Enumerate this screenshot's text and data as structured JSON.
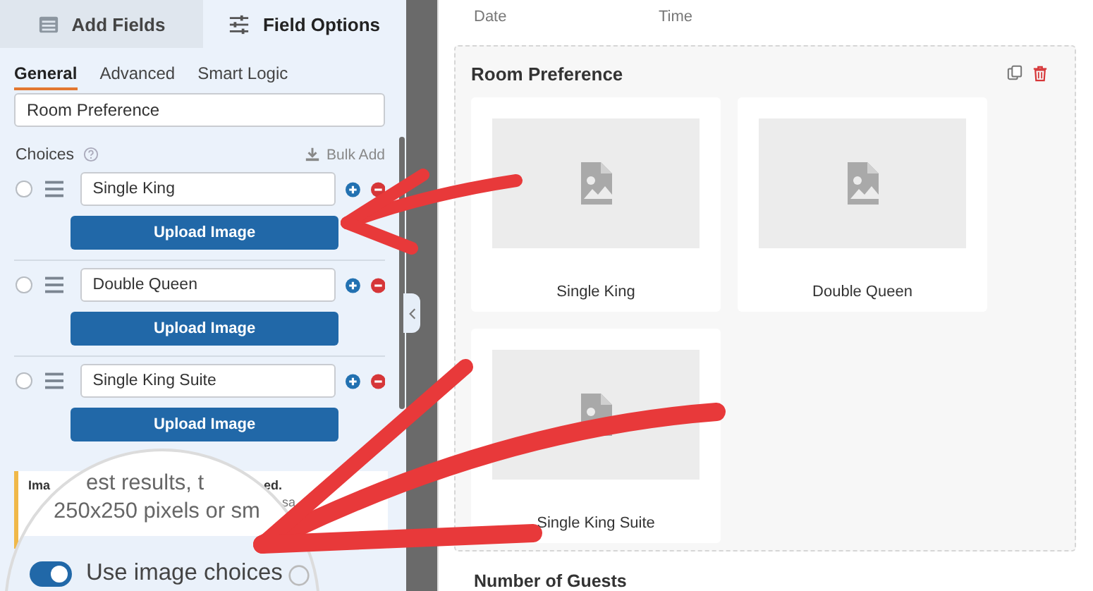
{
  "sidebar": {
    "tabs": [
      {
        "label": "Add Fields",
        "kind": "list",
        "selected": false
      },
      {
        "label": "Field Options",
        "kind": "sliders",
        "selected": true
      }
    ],
    "subtabs": [
      {
        "label": "General",
        "selected": true
      },
      {
        "label": "Advanced",
        "selected": false
      },
      {
        "label": "Smart Logic",
        "selected": false
      }
    ],
    "label_field": {
      "value": "Room Preference"
    },
    "choices_label": "Choices",
    "bulk_add": "Bulk Add",
    "choices": [
      {
        "value": "Single King",
        "selected": false,
        "button": "Upload Image"
      },
      {
        "value": "Double Queen",
        "selected": false,
        "button": "Upload Image"
      },
      {
        "value": "Single King Suite",
        "selected": false,
        "button": "Upload Image"
      }
    ],
    "notice": {
      "parts": [
        "Ima",
        "ed.",
        "sa"
      ]
    },
    "magnifier": {
      "lines": [
        "est results, t",
        "250x250 pixels or sm"
      ],
      "toggle": {
        "label": "Use image choices",
        "on": true
      }
    }
  },
  "preview": {
    "columns": [
      "Date",
      "Time"
    ],
    "field": {
      "title": "Room Preference",
      "choices": [
        {
          "label": "Single King"
        },
        {
          "label": "Double Queen"
        },
        {
          "label": "Single King Suite"
        }
      ]
    },
    "next_field": "Number of Guests"
  }
}
